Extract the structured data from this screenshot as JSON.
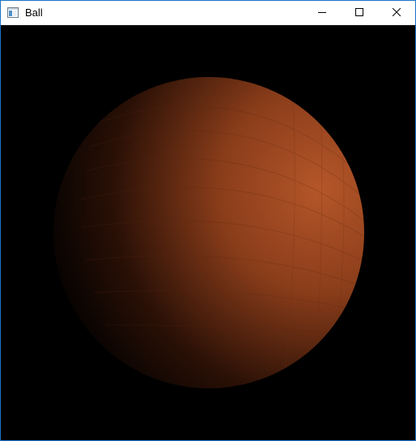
{
  "window": {
    "title": "Ball",
    "controls": {
      "minimize_icon": "minimize-icon",
      "maximize_icon": "maximize-icon",
      "close_icon": "close-icon"
    }
  },
  "scene": {
    "background": "#000000",
    "ball_color": "#8a3d1a",
    "highlight_color": "#b5562a",
    "shadow_color": "#000000"
  }
}
